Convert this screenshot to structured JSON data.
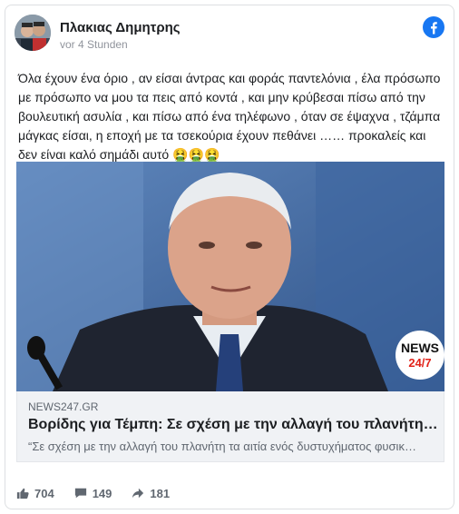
{
  "post": {
    "author": "Πλακιας Δημητρης",
    "time": "vor 4 Stunden",
    "text": "Όλα έχουν ένα όριο , αν είσαι άντρας και φοράς παντελόνια , έλα πρόσωπο με πρόσωπο να μου τα πεις από κοντά , και μην κρύβεσαι πίσω από την βουλευτική ασυλία , και πίσω από ένα τηλέφωνο , όταν σε έψαχνα , τζάμπα μάγκας είσαι, η εποχή με τα τσεκούρια έχουν πεθάνει …… προκαλείς και δεν είναι καλό σημάδι αυτό",
    "emojis": "🤮🤮🤮"
  },
  "link": {
    "domain": "NEWS247.GR",
    "headline": "Βορίδης για Τέμπη: Σε σχέση με την αλλαγή του πλανήτη, …",
    "description": "“Σε σχέση με την αλλαγή του πλανήτη τα αιτία ενός δυστυχήματος φυσικ…",
    "logo_line1": "NEWS",
    "logo_line2": "24/7"
  },
  "stats": {
    "likes": "704",
    "comments": "149",
    "shares": "181"
  },
  "colors": {
    "facebook_blue": "#1877f2",
    "logo_red": "#e2231a"
  },
  "icons": [
    "facebook-icon",
    "like-icon",
    "comment-icon",
    "share-icon"
  ]
}
